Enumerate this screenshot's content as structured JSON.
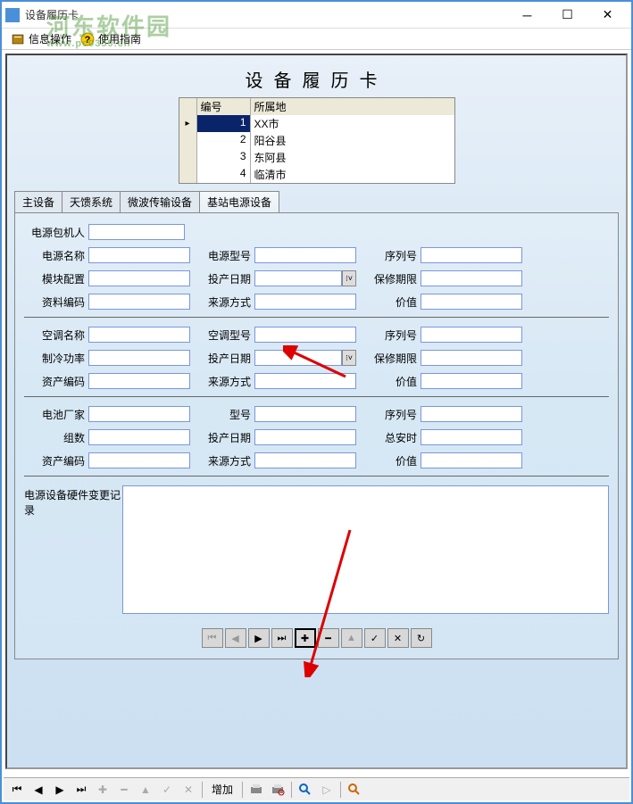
{
  "window": {
    "title": "设备履历卡"
  },
  "watermark": {
    "text": "河东软件园",
    "url": "www.pc0359.cn"
  },
  "menu": {
    "info": "信息操作",
    "guide": "使用指南"
  },
  "form": {
    "title": "设备履历卡",
    "grid": {
      "headers": {
        "id": "编号",
        "loc": "所属地"
      },
      "rows": [
        {
          "id": "1",
          "loc": "XX市"
        },
        {
          "id": "2",
          "loc": "阳谷县"
        },
        {
          "id": "3",
          "loc": "东阿县"
        },
        {
          "id": "4",
          "loc": "临清市"
        }
      ]
    },
    "tabs": [
      "主设备",
      "天馈系统",
      "微波传输设备",
      "基站电源设备"
    ],
    "section1": {
      "owner": "电源包机人",
      "name": "电源名称",
      "model": "电源型号",
      "serial": "序列号",
      "module": "模块配置",
      "proddate": "投产日期",
      "warranty": "保修期限",
      "matcode": "资料编码",
      "source": "来源方式",
      "value": "价值"
    },
    "section2": {
      "acname": "空调名称",
      "acmodel": "空调型号",
      "serial": "序列号",
      "power": "制冷功率",
      "proddate": "投产日期",
      "warranty": "保修期限",
      "assetcode": "资产编码",
      "source": "来源方式",
      "value": "价值"
    },
    "section3": {
      "battery": "电池厂家",
      "model": "型号",
      "serial": "序列号",
      "groups": "组数",
      "proddate": "投产日期",
      "amphour": "总安时",
      "assetcode": "资产编码",
      "source": "来源方式",
      "value": "价值"
    },
    "changelog": "电源设备硬件变更记录"
  },
  "bottom": {
    "add": "增加"
  }
}
